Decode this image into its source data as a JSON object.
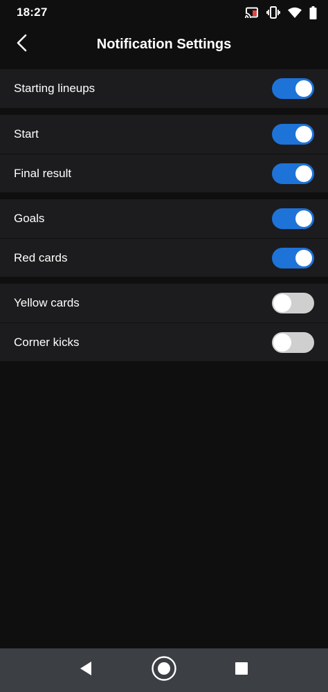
{
  "status_bar": {
    "time": "18:27",
    "icons": [
      "cast-icon",
      "vibrate-icon",
      "wifi-icon",
      "battery-icon"
    ]
  },
  "header": {
    "title": "Notification Settings",
    "back_icon": "chevron-left-icon"
  },
  "groups": [
    {
      "items": [
        {
          "label": "Starting lineups",
          "enabled": true
        }
      ]
    },
    {
      "items": [
        {
          "label": "Start",
          "enabled": true
        },
        {
          "label": "Final result",
          "enabled": true
        }
      ]
    },
    {
      "items": [
        {
          "label": "Goals",
          "enabled": true
        },
        {
          "label": "Red cards",
          "enabled": true
        }
      ]
    },
    {
      "items": [
        {
          "label": "Yellow cards",
          "enabled": false
        },
        {
          "label": "Corner kicks",
          "enabled": false
        }
      ]
    }
  ],
  "colors": {
    "background": "#0f0f0f",
    "row_background": "#1c1c1e",
    "toggle_on": "#1e73d8",
    "toggle_off": "#cfcfcf",
    "nav_bar": "#3c3f44"
  },
  "nav_bar": {
    "buttons": [
      "back-triangle-icon",
      "home-circle-icon",
      "recents-square-icon"
    ]
  }
}
